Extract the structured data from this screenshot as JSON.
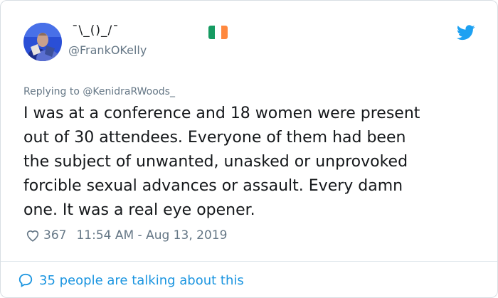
{
  "author": {
    "display_name": "¯\\_()_/¯",
    "handle": "@FrankOKelly",
    "avatar": "avatar-photo",
    "badge_icon": "ireland-flag-icon",
    "badge_colors": [
      "#169b62",
      "#ffffff",
      "#ff883e"
    ]
  },
  "brand": {
    "icon": "twitter-bird-icon",
    "color": "#1da1f2"
  },
  "reply": {
    "prefix": "Replying to ",
    "mention": "@KenidraRWoods_"
  },
  "tweet": {
    "text": "I was at a conference and 18 women were present\nout of 30 attendees.  Everyone of them had been\nthe subject of unwanted, unasked or unprovoked\nforcible sexual advances or assault.  Every damn\none.  It was a real eye opener."
  },
  "meta": {
    "like_icon": "heart-outline-icon",
    "likes": "367",
    "timestamp": "11:54 AM - Aug 13, 2019"
  },
  "footer": {
    "icon": "speech-bubble-icon",
    "talking": "35 people are talking about this",
    "accent": "#1b95e0"
  }
}
